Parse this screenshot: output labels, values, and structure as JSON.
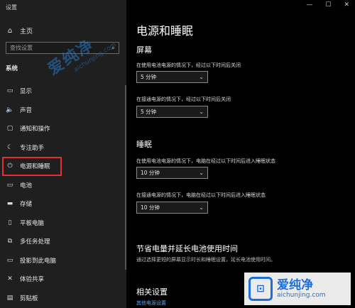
{
  "window": {
    "title": "设置",
    "minimize": "—",
    "maximize": "☐",
    "close": "✕"
  },
  "sidebar": {
    "home": {
      "label": "主页",
      "icon": "⌂"
    },
    "search": {
      "placeholder": "查找设置",
      "icon": "⌕"
    },
    "section": "系统",
    "items": [
      {
        "label": "显示",
        "icon": "▭"
      },
      {
        "label": "声音",
        "icon": "🔈"
      },
      {
        "label": "通知和操作",
        "icon": "▢"
      },
      {
        "label": "专注助手",
        "icon": "☾"
      },
      {
        "label": "电源和睡眠",
        "icon": "⏻"
      },
      {
        "label": "电池",
        "icon": "▭"
      },
      {
        "label": "存储",
        "icon": "▬"
      },
      {
        "label": "平板电脑",
        "icon": "▯"
      },
      {
        "label": "多任务处理",
        "icon": "⧉"
      },
      {
        "label": "投影到此电脑",
        "icon": "▭"
      },
      {
        "label": "体验共享",
        "icon": "✕"
      },
      {
        "label": "剪贴板",
        "icon": "▤"
      }
    ],
    "selected_index": 4,
    "highlight_color": "#e23131"
  },
  "main": {
    "title": "电源和睡眠",
    "screen": {
      "heading": "屏幕",
      "battery_label": "在使用电池电源的情况下，经过以下时间后关闭",
      "battery_value": "5 分钟",
      "plugged_label": "在接通电源的情况下，经过以下时间后关闭",
      "plugged_value": "5 分钟"
    },
    "sleep": {
      "heading": "睡眠",
      "battery_label": "在使用电池电源的情况下，电脑在经过以下时间后进入睡眠状态",
      "battery_value": "10 分钟",
      "plugged_label": "在接通电源的情况下，电脑在经过以下时间后进入睡眠状态",
      "plugged_value": "10 分钟"
    },
    "save": {
      "heading": "节省电量并延长电池使用时间",
      "desc": "通过选择更短的屏幕显示时长和睡眠设置，延长电池使用时间。"
    },
    "related": {
      "heading": "相关设置",
      "link": "其他电源设置"
    }
  },
  "watermark": {
    "text": "爱纯净",
    "url": "aichunjing.com"
  },
  "colors": {
    "link": "#4ea6ff",
    "sidebar_bg": "#1f1f1f",
    "content_bg": "#000000"
  }
}
